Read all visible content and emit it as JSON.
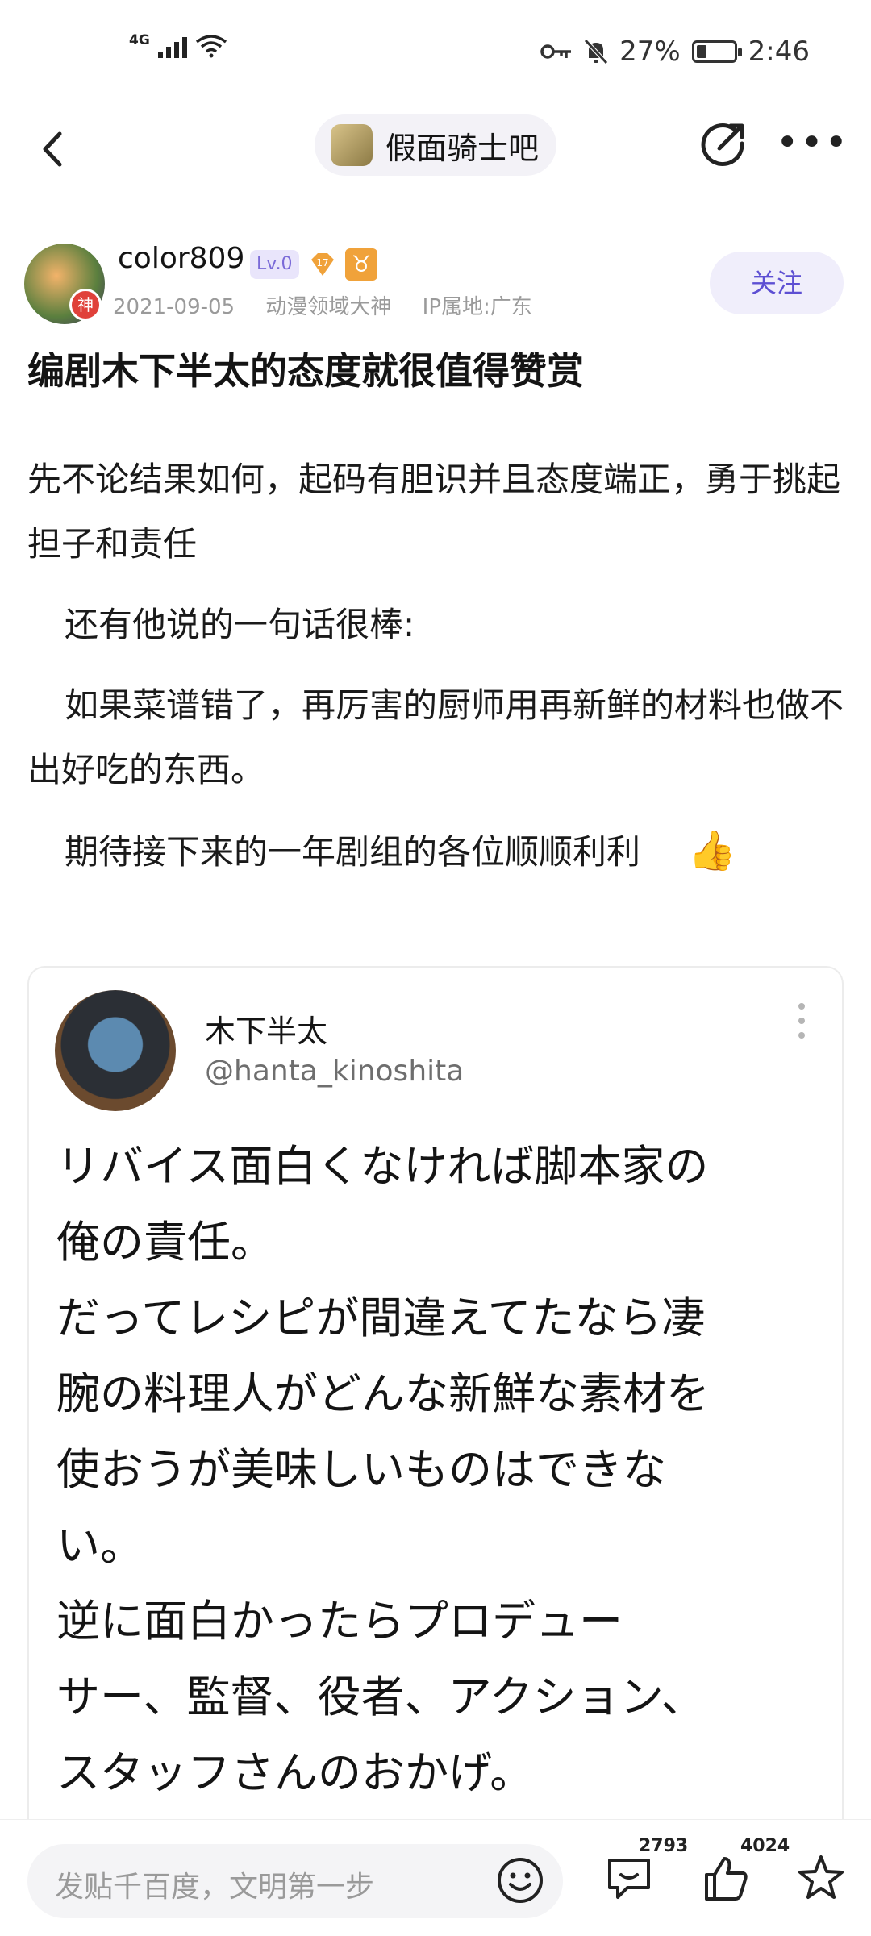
{
  "status_bar": {
    "network": "4G",
    "battery_percent": "27%",
    "battery_level": 0.27,
    "time": "2:46"
  },
  "nav": {
    "forum_name": "假面骑士吧"
  },
  "author": {
    "username": "color809",
    "level": "Lv.0",
    "badge_number": "17",
    "zodiac": "♉",
    "avatar_badge": "神",
    "date": "2021-09-05",
    "title": "动漫领域大神",
    "ip_location": "IP属地:广东",
    "follow_label": "关注"
  },
  "post": {
    "title": "编剧木下半太的态度就很值得赞赏",
    "paragraphs": [
      "先不论结果如何，起码有胆识并且态度端正，勇于挑起担子和责任",
      "还有他说的一句话很棒:",
      "如果菜谱错了，再厉害的厨师用再新鲜的材料也做不出好吃的东西。",
      "期待接下来的一年剧组的各位顺顺利利"
    ],
    "emoji": "👍"
  },
  "tweet": {
    "name": "木下半太",
    "handle": "@hanta_kinoshita",
    "text": "リバイス面白くなければ脚本家の\n俺の責任。\nだってレシピが間違えてたなら凄\n腕の料理人がどんな新鮮な素材を\n使おうが美味しいものはできな\nい。\n逆に面白かったらプロデュー\nサー、監督、役者、アクション、\nスタッフさんのおかげ。"
  },
  "bottom_bar": {
    "input_placeholder": "发贴千百度，文明第一步",
    "comment_count": "2793",
    "like_count": "4024"
  },
  "colors": {
    "accent": "#5d4fd3",
    "follow_bg": "#f0eefb",
    "muted": "#9a9a9a"
  }
}
